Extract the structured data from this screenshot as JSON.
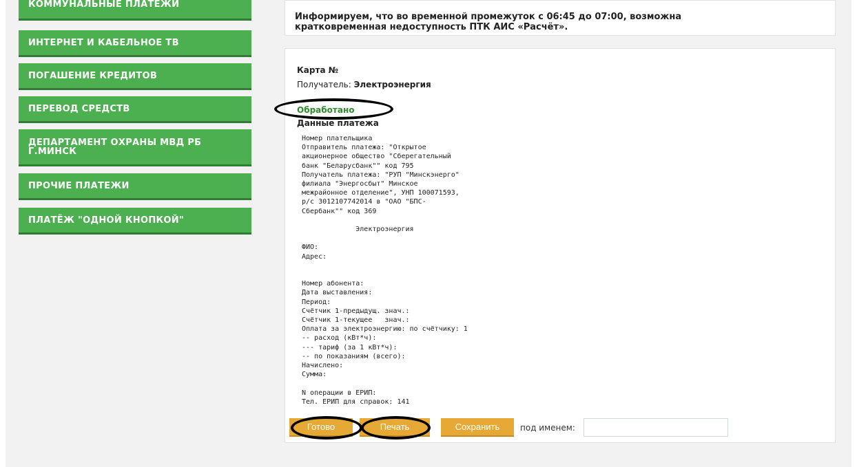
{
  "sidebar": {
    "items": [
      {
        "label": "Коммунальные платежи"
      },
      {
        "label": "Интернет и кабельное ТВ"
      },
      {
        "label": "Погашение кредитов"
      },
      {
        "label": "Перевод средств"
      },
      {
        "label": "Департамент охраны МВД РБ г.Минск"
      },
      {
        "label": "Прочие платежи"
      },
      {
        "label": "Платёж \"одной кнопкой\""
      }
    ]
  },
  "notice": {
    "line1": "Информируем, что во временной промежуток с 06:45 до 07:00, возможна",
    "line2": "кратковременная недоступность ПТК АИС «Расчёт»."
  },
  "receipt": {
    "card_label": "Карта №",
    "recipient_label": "Получатель:",
    "recipient_value": "Электроэнергия",
    "status": "Обработано",
    "payment_data_title": "Данные платежа",
    "details": "Номер плательщика\nОтправитель платежа: \"Открытое\nакционерное общество \"Сберегательный\nбанк \"Беларусбанк\"\" код 795\nПолучатель платежа: \"РУП \"Минскэнерго\"\nфилиала \"Энергосбыт\" Минское\nмежрайонное отделение\", УНП 100071593,\nр/с 3012107742014 в \"ОАО \"БПС-\nСбербанк\"\" код 369\n\n             Электроэнергия\n\nФИО:\nАдрес:\n\n\nНомер абонента:\nДата выставления:\nПериод:\nСчётчик 1-предыдущ. знач.:\nСчётчик 1-текущее   знач.:\nОплата за электроэнергию: по счётчику: 1\n-- расход (кВт*ч):\n--- тариф (за 1 кВт*ч):\n-- по показаниям (всего):\nНачислено:\nСумма:\n\nN операции в ЕРИП:\nТел. ЕРИП для справок: 141"
  },
  "actions": {
    "done_label": "Готово",
    "print_label": "Печать",
    "save_label": "Сохранить",
    "save_as_label": "под именем:",
    "save_as_value": ""
  },
  "colors": {
    "menu_green": "#4caf50",
    "status_green": "#2e8b2e",
    "button_orange": "#e7a936"
  }
}
